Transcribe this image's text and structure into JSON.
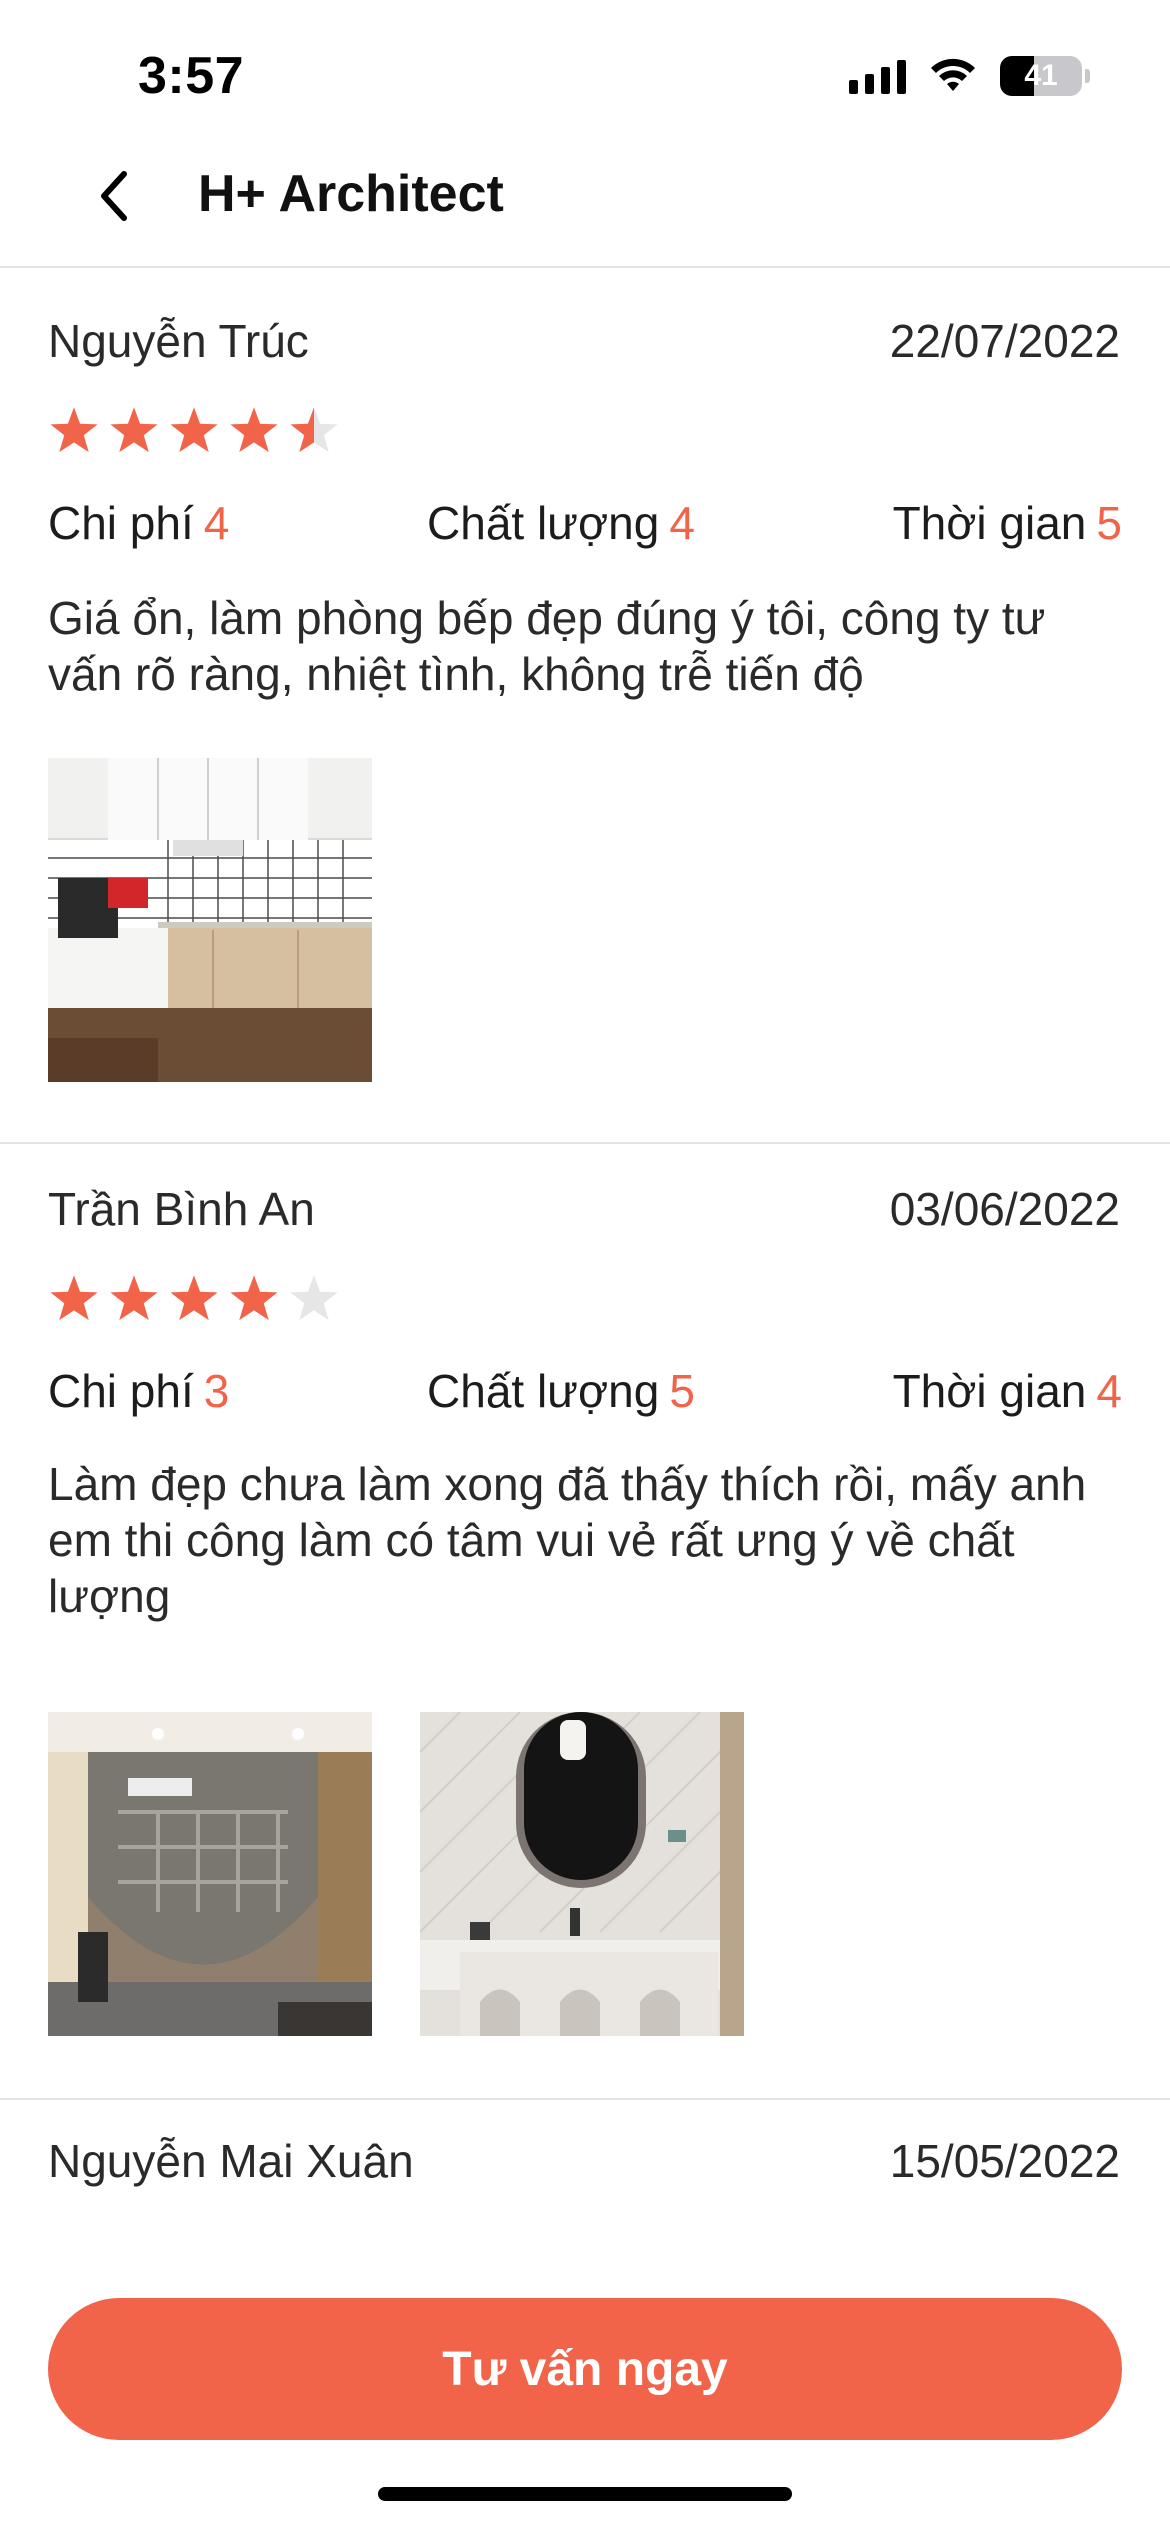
{
  "status_bar": {
    "time": "3:57",
    "battery": "41",
    "battery_level": 0.41
  },
  "header": {
    "title": "H+ Architect",
    "back_icon": "chevron-left-icon"
  },
  "colors": {
    "accent": "#f2644a",
    "star_empty": "#e6e6e6",
    "divider": "#e3e3e6"
  },
  "labels": {
    "cost": "Chi phí",
    "quality": "Chất lượng",
    "time": "Thời gian"
  },
  "reviews": [
    {
      "name": "Nguyễn Trúc",
      "date": "22/07/2022",
      "rating": 4.5,
      "cost": "4",
      "quality": "4",
      "time": "5",
      "comment": "Giá ổn, làm phòng bếp đẹp đúng ý tôi, công ty tư vấn rõ ràng, nhiệt tình, không trễ tiến độ",
      "photos": [
        "kitchen-photo"
      ]
    },
    {
      "name": "Trần Bình An",
      "date": "03/06/2022",
      "rating": 4,
      "cost": "3",
      "quality": "5",
      "time": "4",
      "comment": "Làm đẹp chưa làm xong đã thấy thích rồi, mấy anh em thi công làm có tâm vui vẻ rất ưng ý về chất lượng",
      "photos": [
        "shelf-room-photo",
        "bathroom-photo"
      ]
    },
    {
      "name": "Nguyễn Mai Xuân",
      "date": "15/05/2022"
    }
  ],
  "cta": {
    "label": "Tư vấn ngay"
  }
}
